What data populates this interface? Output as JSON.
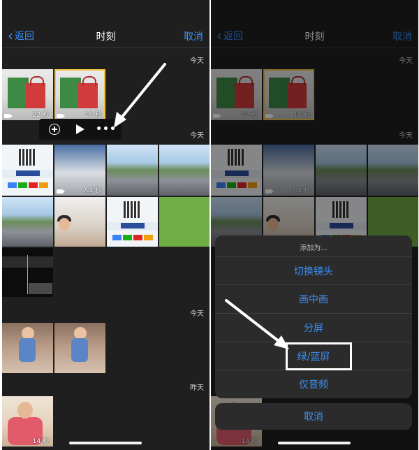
{
  "nav": {
    "back_label": "返回",
    "title": "时刻",
    "cancel_label": "取消"
  },
  "left": {
    "sections": [
      {
        "day": "今天"
      },
      {
        "day": "今天"
      },
      {
        "day": "今天"
      },
      {
        "day": "昨天"
      }
    ],
    "durations": {
      "bag1": "22 秒",
      "bag2": "16 秒",
      "road": "7.3 秒",
      "toddler": "14 秒"
    },
    "action_bar": {
      "add_icon": "plus-circle-icon",
      "play_icon": "play-icon",
      "more_icon": "more-icon"
    }
  },
  "right": {
    "sheet": {
      "title": "添加为...",
      "options": [
        "切换镜头",
        "画中画",
        "分屏",
        "绿/蓝屏",
        "仅音频"
      ],
      "cancel": "取消",
      "highlighted": "绿/蓝屏"
    }
  },
  "colors": {
    "accent": "#3a8ff5",
    "background": "#1f1f1f",
    "selection": "#f4c543"
  }
}
